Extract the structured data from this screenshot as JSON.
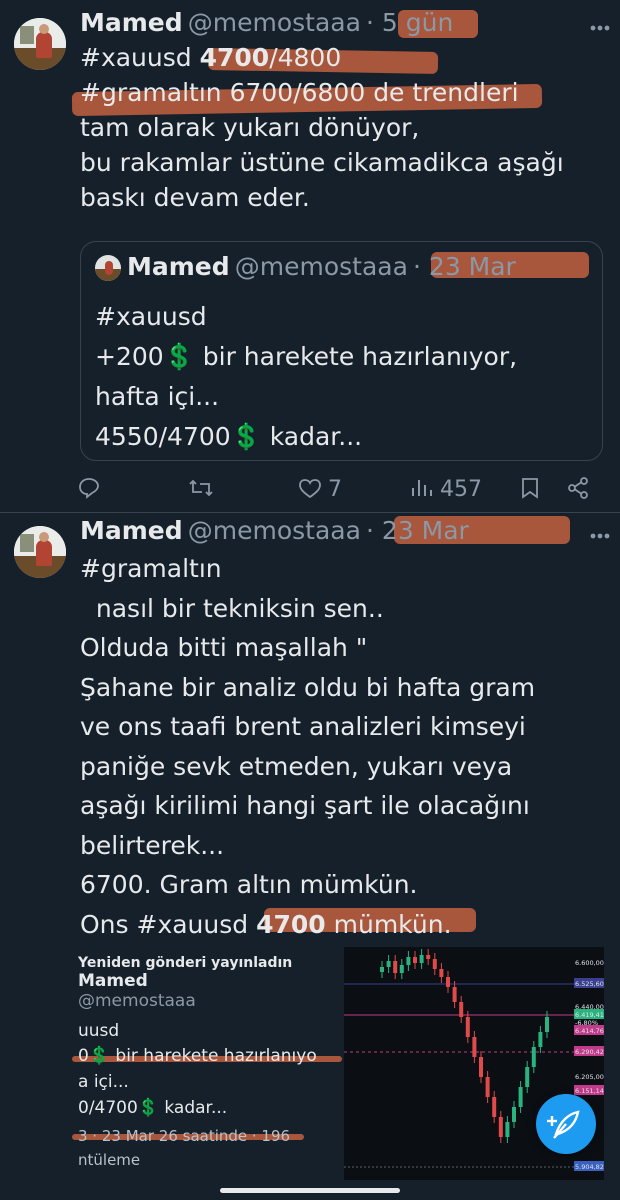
{
  "tweet1": {
    "name": "Mamed",
    "handle": "@memostaaa",
    "time": "· 5 gün",
    "lines": [
      [
        "#xauusd ",
        "4700",
        "/4800"
      ],
      "#gramaltın 6700/6800 de trendleri",
      "tam olarak yukarı dönüyor,",
      "bu rakamlar üstüne cikamadikca aşağı",
      "baskı devam eder."
    ],
    "quote": {
      "name": "Mamed",
      "handle": "@memostaaa",
      "time": "· 23 Mar",
      "lines": [
        "#xauusd",
        "+200",
        " bir harekete hazırlanıyor,",
        "hafta içi...",
        "4550/4700",
        " kadar..."
      ]
    },
    "actions": {
      "likes": "7",
      "views": "457"
    }
  },
  "tweet2": {
    "name": "Mamed",
    "handle": "@memostaaa",
    "time": "· 23 Mar",
    "lines": [
      "#gramaltın",
      "  nasıl bir tekniksin sen..",
      "Olduda bitti maşallah \"",
      "Şahane bir analiz oldu bi hafta gram",
      "ve ons taafi brent analizleri kimseyi",
      "paniğe sevk etmeden, yukarı veya",
      "aşağı kirilimi hangi şart ile olacağını",
      "belirterek...",
      "6700. Gram altın mümkün."
    ],
    "last_line": [
      "Ons #xauusd ",
      "4700",
      " mümkün",
      "."
    ],
    "embed": {
      "repost_label": "Yeniden gönderi yayınladın",
      "name": "Mamed",
      "handle": "@memostaaa",
      "line1": "uusd",
      "line2a": "0",
      "line2b": " bir harekete hazırlanıyo",
      "line3": "a içi...",
      "line4a": "0/4700",
      "line4b": " kadar...",
      "line5": "3 · 23 Mar 26 saatinde · 196",
      "line6": "ntüleme",
      "chart_prices": [
        "6.600,00",
        "6.525,60",
        "6.440,00",
        "6.419,41",
        "-6,80%",
        "6.414,76",
        "6.290,42",
        "6.205,00",
        "6.151,14",
        "5.904,82"
      ]
    }
  },
  "icons": {
    "dollar": "💲"
  },
  "colors": {
    "background": "#15202b",
    "accent": "#1d9bf0",
    "highlight": "#c2603f"
  }
}
